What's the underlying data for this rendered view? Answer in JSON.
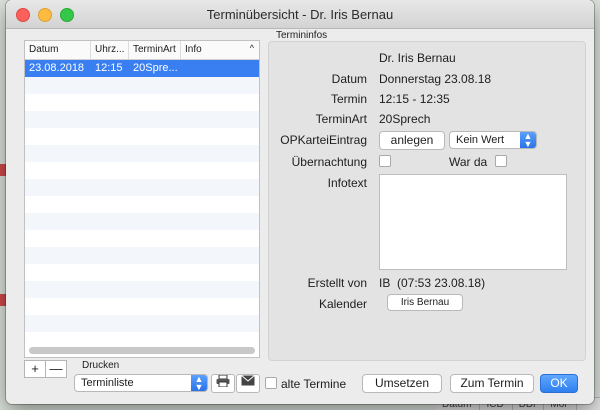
{
  "window": {
    "title": "Terminübersicht - Dr. Iris Bernau"
  },
  "list": {
    "columns": [
      "Datum",
      "Uhrz...",
      "TerminArt",
      "Info"
    ],
    "sort_indicator": "^",
    "rows": [
      {
        "datum": "23.08.2018",
        "uhrzeit": "12:15",
        "terminart": "20Spre...",
        "info": ""
      }
    ]
  },
  "list_controls": {
    "add": "+",
    "remove": "—"
  },
  "print": {
    "label": "Drucken",
    "selected": "Terminliste",
    "print_icon": "printer-icon",
    "mail_icon": "envelope-icon"
  },
  "alte_termine": {
    "label": "alte Termine",
    "checked": false
  },
  "buttons": {
    "umsetzen": "Umsetzen",
    "zum_termin": "Zum Termin",
    "ok": "OK"
  },
  "details": {
    "group_label": "Termininfos",
    "name": "Dr. Iris Bernau",
    "datum_label": "Datum",
    "datum_value": "Donnerstag 23.08.18",
    "termin_label": "Termin",
    "termin_value": "12:15 - 12:35",
    "terminart_label": "TerminArt",
    "terminart_value": "20Sprech",
    "opkartei_label": "OPKarteiEintrag",
    "anlegen_button": "anlegen",
    "kein_wert_select": "Kein Wert",
    "uebernachtung_label": "Übernachtung",
    "war_da_label": "War da",
    "infotext_label": "Infotext",
    "infotext_value": "",
    "erstellt_von_label": "Erstellt von",
    "erstellt_von_value": "IB",
    "erstellt_von_time": "(07:53 23.08.18)",
    "kalender_label": "Kalender",
    "kalender_button": "Iris Bernau"
  },
  "background": {
    "columns": [
      "Datum",
      "ICD",
      "DDi",
      "Mor"
    ]
  },
  "colors": {
    "accent": "#3a7ff2",
    "selection": "#3a7ff2"
  }
}
